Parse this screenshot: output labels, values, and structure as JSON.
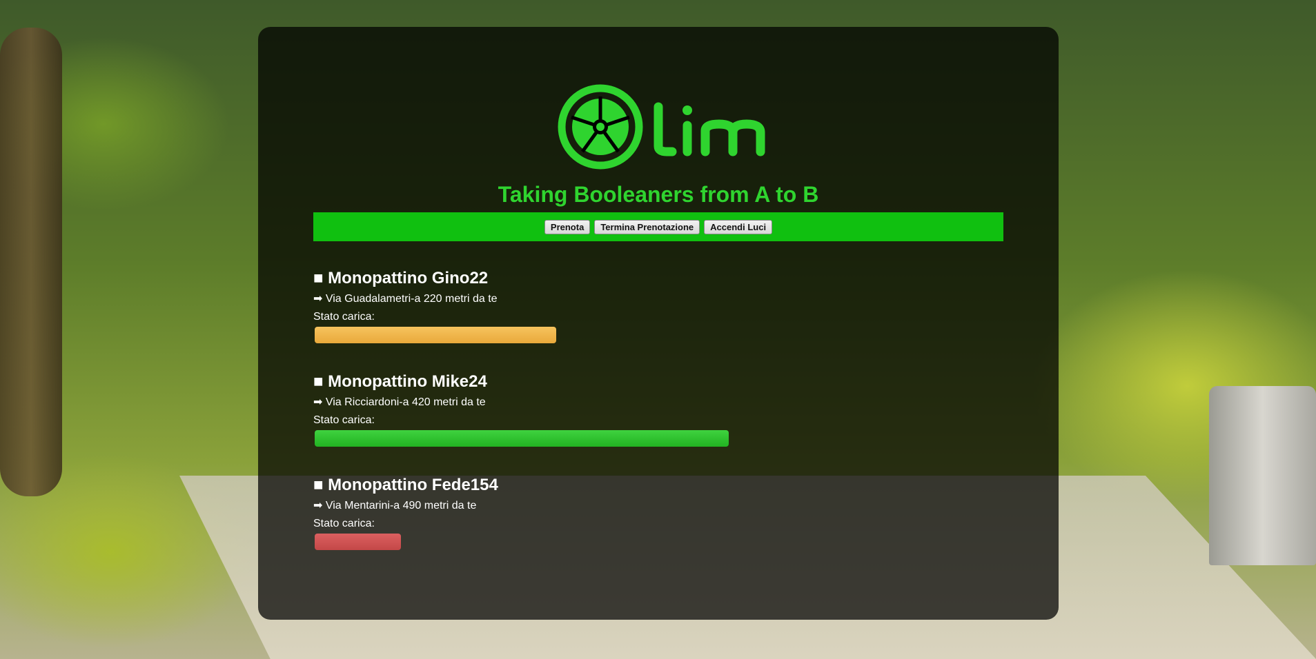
{
  "brand": {
    "logo_name": "lim",
    "tagline": "Taking Booleaners from A to B",
    "color": "#2fd42f"
  },
  "nav": {
    "buttons": [
      "Prenota",
      "Termina Prenotazione",
      "Accendi Luci"
    ],
    "bar_color": "#10c010"
  },
  "charge_label": "Stato carica:",
  "scooters": [
    {
      "name": "■ Monopattino Gino22",
      "address": "➡ Via Guadalametri-a 220 metri da te",
      "charge_fraction": 0.35,
      "charge_color": "#e9a93b"
    },
    {
      "name": "■ Monopattino Mike24",
      "address": "➡ Via Ricciardoni-a 420 metri da te",
      "charge_fraction": 0.6,
      "charge_color": "#22b322"
    },
    {
      "name": "■ Monopattino Fede154",
      "address": "➡ Via Mentarini-a 490 metri da te",
      "charge_fraction": 0.125,
      "charge_color": "#c44848"
    }
  ]
}
